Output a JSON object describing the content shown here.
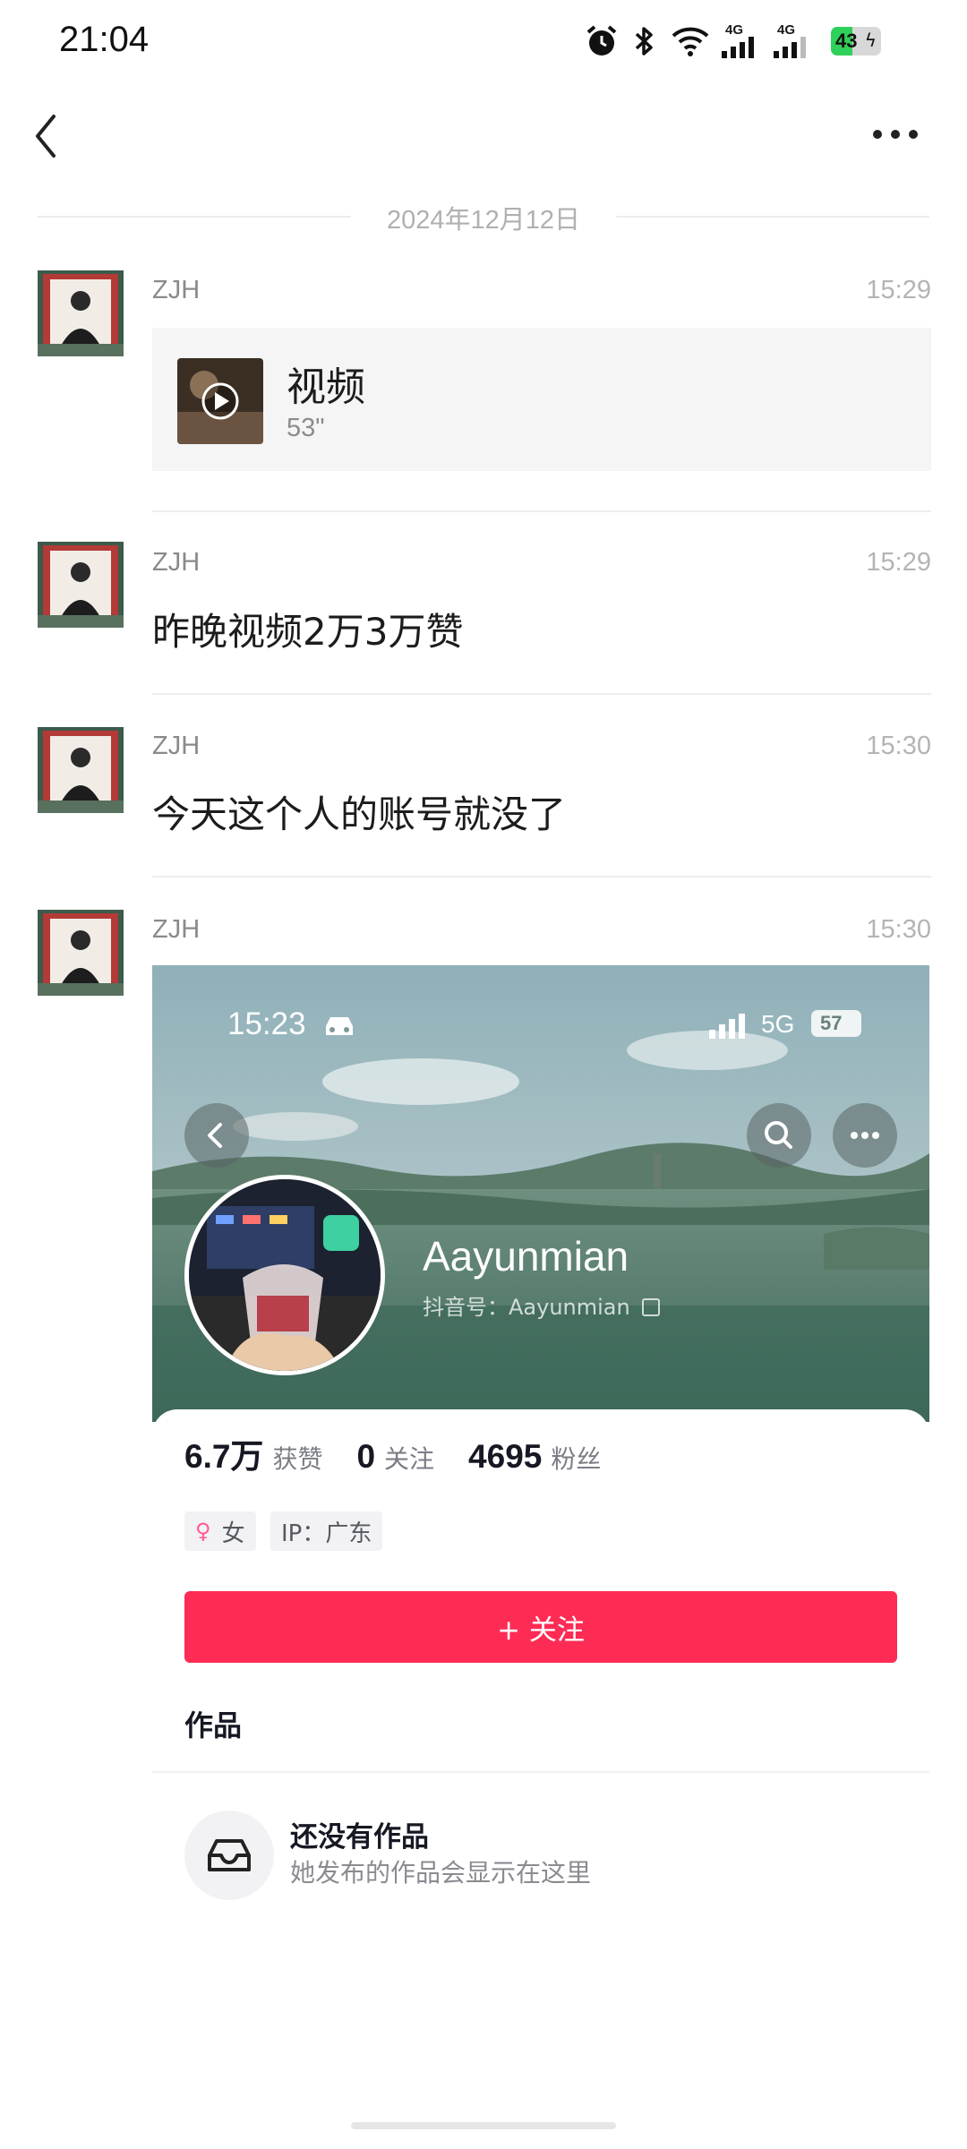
{
  "status_bar": {
    "time": "21:04",
    "net1": "4G",
    "net2": "4G",
    "battery": "43"
  },
  "chat": {
    "date_divider": "2024年12月12日",
    "messages": [
      {
        "sender": "ZJH",
        "time": "15:29",
        "type": "video",
        "title": "视频",
        "duration": "53\""
      },
      {
        "sender": "ZJH",
        "time": "15:29",
        "type": "text",
        "text": "昨晚视频2万3万赞"
      },
      {
        "sender": "ZJH",
        "time": "15:30",
        "type": "text",
        "text": "今天这个人的账号就没了"
      },
      {
        "sender": "ZJH",
        "time": "15:30",
        "type": "image"
      }
    ]
  },
  "shared_profile": {
    "status_time": "15:23",
    "status_net": "5G",
    "status_battery": "57",
    "name": "Aayunmian",
    "id_label": "抖音号：",
    "id_value": "Aayunmian",
    "stats": [
      {
        "value": "6.7万",
        "label": "获赞"
      },
      {
        "value": "0",
        "label": "关注"
      },
      {
        "value": "4695",
        "label": "粉丝"
      }
    ],
    "tag_gender": "女",
    "tag_ip": "IP：广东",
    "follow_button": "+ 关注",
    "works_title": "作品",
    "empty_title": "还没有作品",
    "empty_sub": "她发布的作品会显示在这里"
  },
  "colors": {
    "accent": "#fe2c55",
    "battery": "#2fd15a",
    "card_bg": "#f5f5f5"
  }
}
